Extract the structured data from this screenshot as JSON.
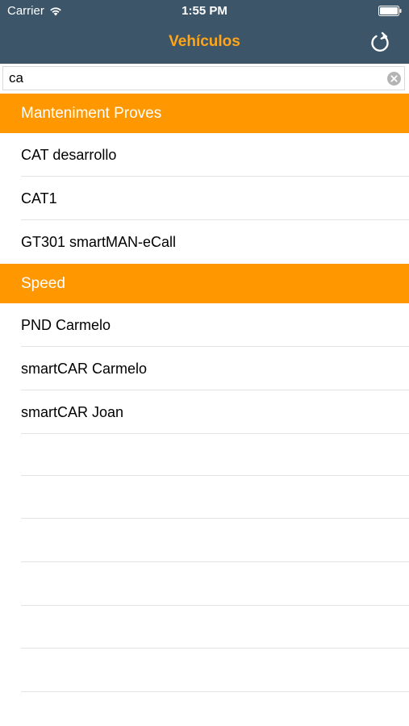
{
  "status": {
    "carrier": "Carrier",
    "time": "1:55 PM"
  },
  "nav": {
    "title": "Vehículos"
  },
  "search": {
    "value": "ca"
  },
  "sections": [
    {
      "header": "Manteniment Proves",
      "items": [
        "CAT desarrollo",
        "CAT1",
        "GT301 smartMAN-eCall"
      ]
    },
    {
      "header": "Speed",
      "items": [
        "PND Carmelo",
        "smartCAR Carmelo",
        "smartCAR Joan"
      ]
    }
  ],
  "colors": {
    "nav_bg": "#3c5568",
    "accent": "#ffa51a",
    "section_bg": "#ff9800"
  }
}
